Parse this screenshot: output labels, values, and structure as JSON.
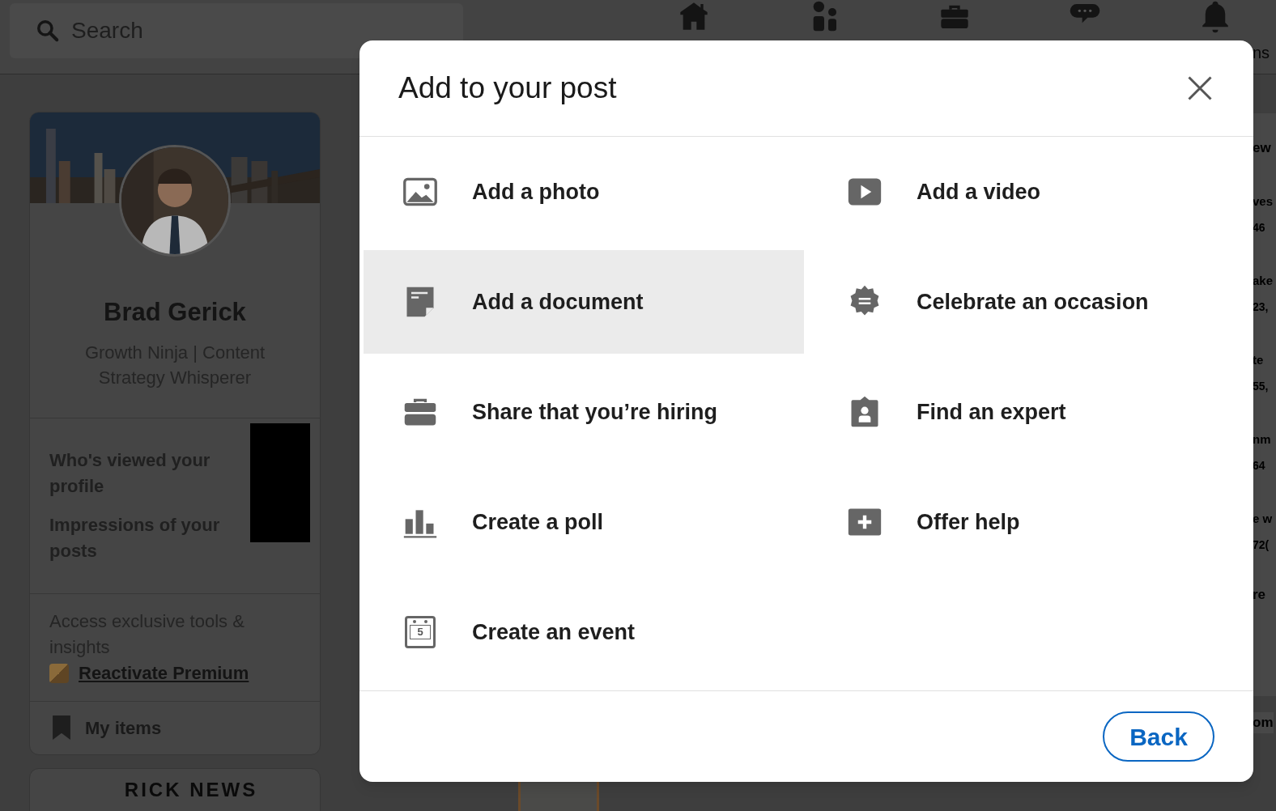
{
  "header": {
    "search": {
      "placeholder": "Search"
    },
    "nav": [
      {
        "kind": "home"
      },
      {
        "kind": "people"
      },
      {
        "kind": "briefcase"
      },
      {
        "kind": "chat"
      },
      {
        "kind": "bell",
        "label": "ns"
      }
    ]
  },
  "profile": {
    "name": "Brad Gerick",
    "headline": "Growth Ninja | Content Strategy Whisperer",
    "stats": [
      "Who's viewed your profile",
      "Impressions of your posts"
    ],
    "premium_text": "Access exclusive tools & insights",
    "premium_link": "Reactivate Premium",
    "my_items": "My items"
  },
  "newsletter_card": {
    "title": "RICK NEWS"
  },
  "right_column": {
    "heading": "ew",
    "items": [
      {
        "title": "ves",
        "meta": "46"
      },
      {
        "title": "ake",
        "meta": "23,"
      },
      {
        "title": "te",
        "meta": "55,"
      },
      {
        "title": "nm",
        "meta": "64"
      },
      {
        "title": "e w",
        "meta": "72("
      }
    ],
    "more": "re",
    "footer": "om"
  },
  "modal": {
    "title": "Add to your post",
    "items": [
      {
        "label": "Add a photo",
        "selected": false
      },
      {
        "kind": "video",
        "label": "Add a video",
        "selected": false
      },
      {
        "kind": "document",
        "label": "Add a document",
        "selected": true
      },
      {
        "kind": "occasion",
        "label": "Celebrate an occasion",
        "selected": false
      },
      {
        "kind": "hiring",
        "label": "Share that you’re hiring",
        "selected": false
      },
      {
        "kind": "expert",
        "label": "Find an expert",
        "selected": false
      },
      {
        "kind": "poll",
        "label": "Create a poll",
        "selected": false
      },
      {
        "kind": "help",
        "label": "Offer help",
        "selected": false
      },
      {
        "kind": "event",
        "label": "Create an event",
        "selected": false,
        "day": "5"
      }
    ],
    "back_button": "Back"
  }
}
